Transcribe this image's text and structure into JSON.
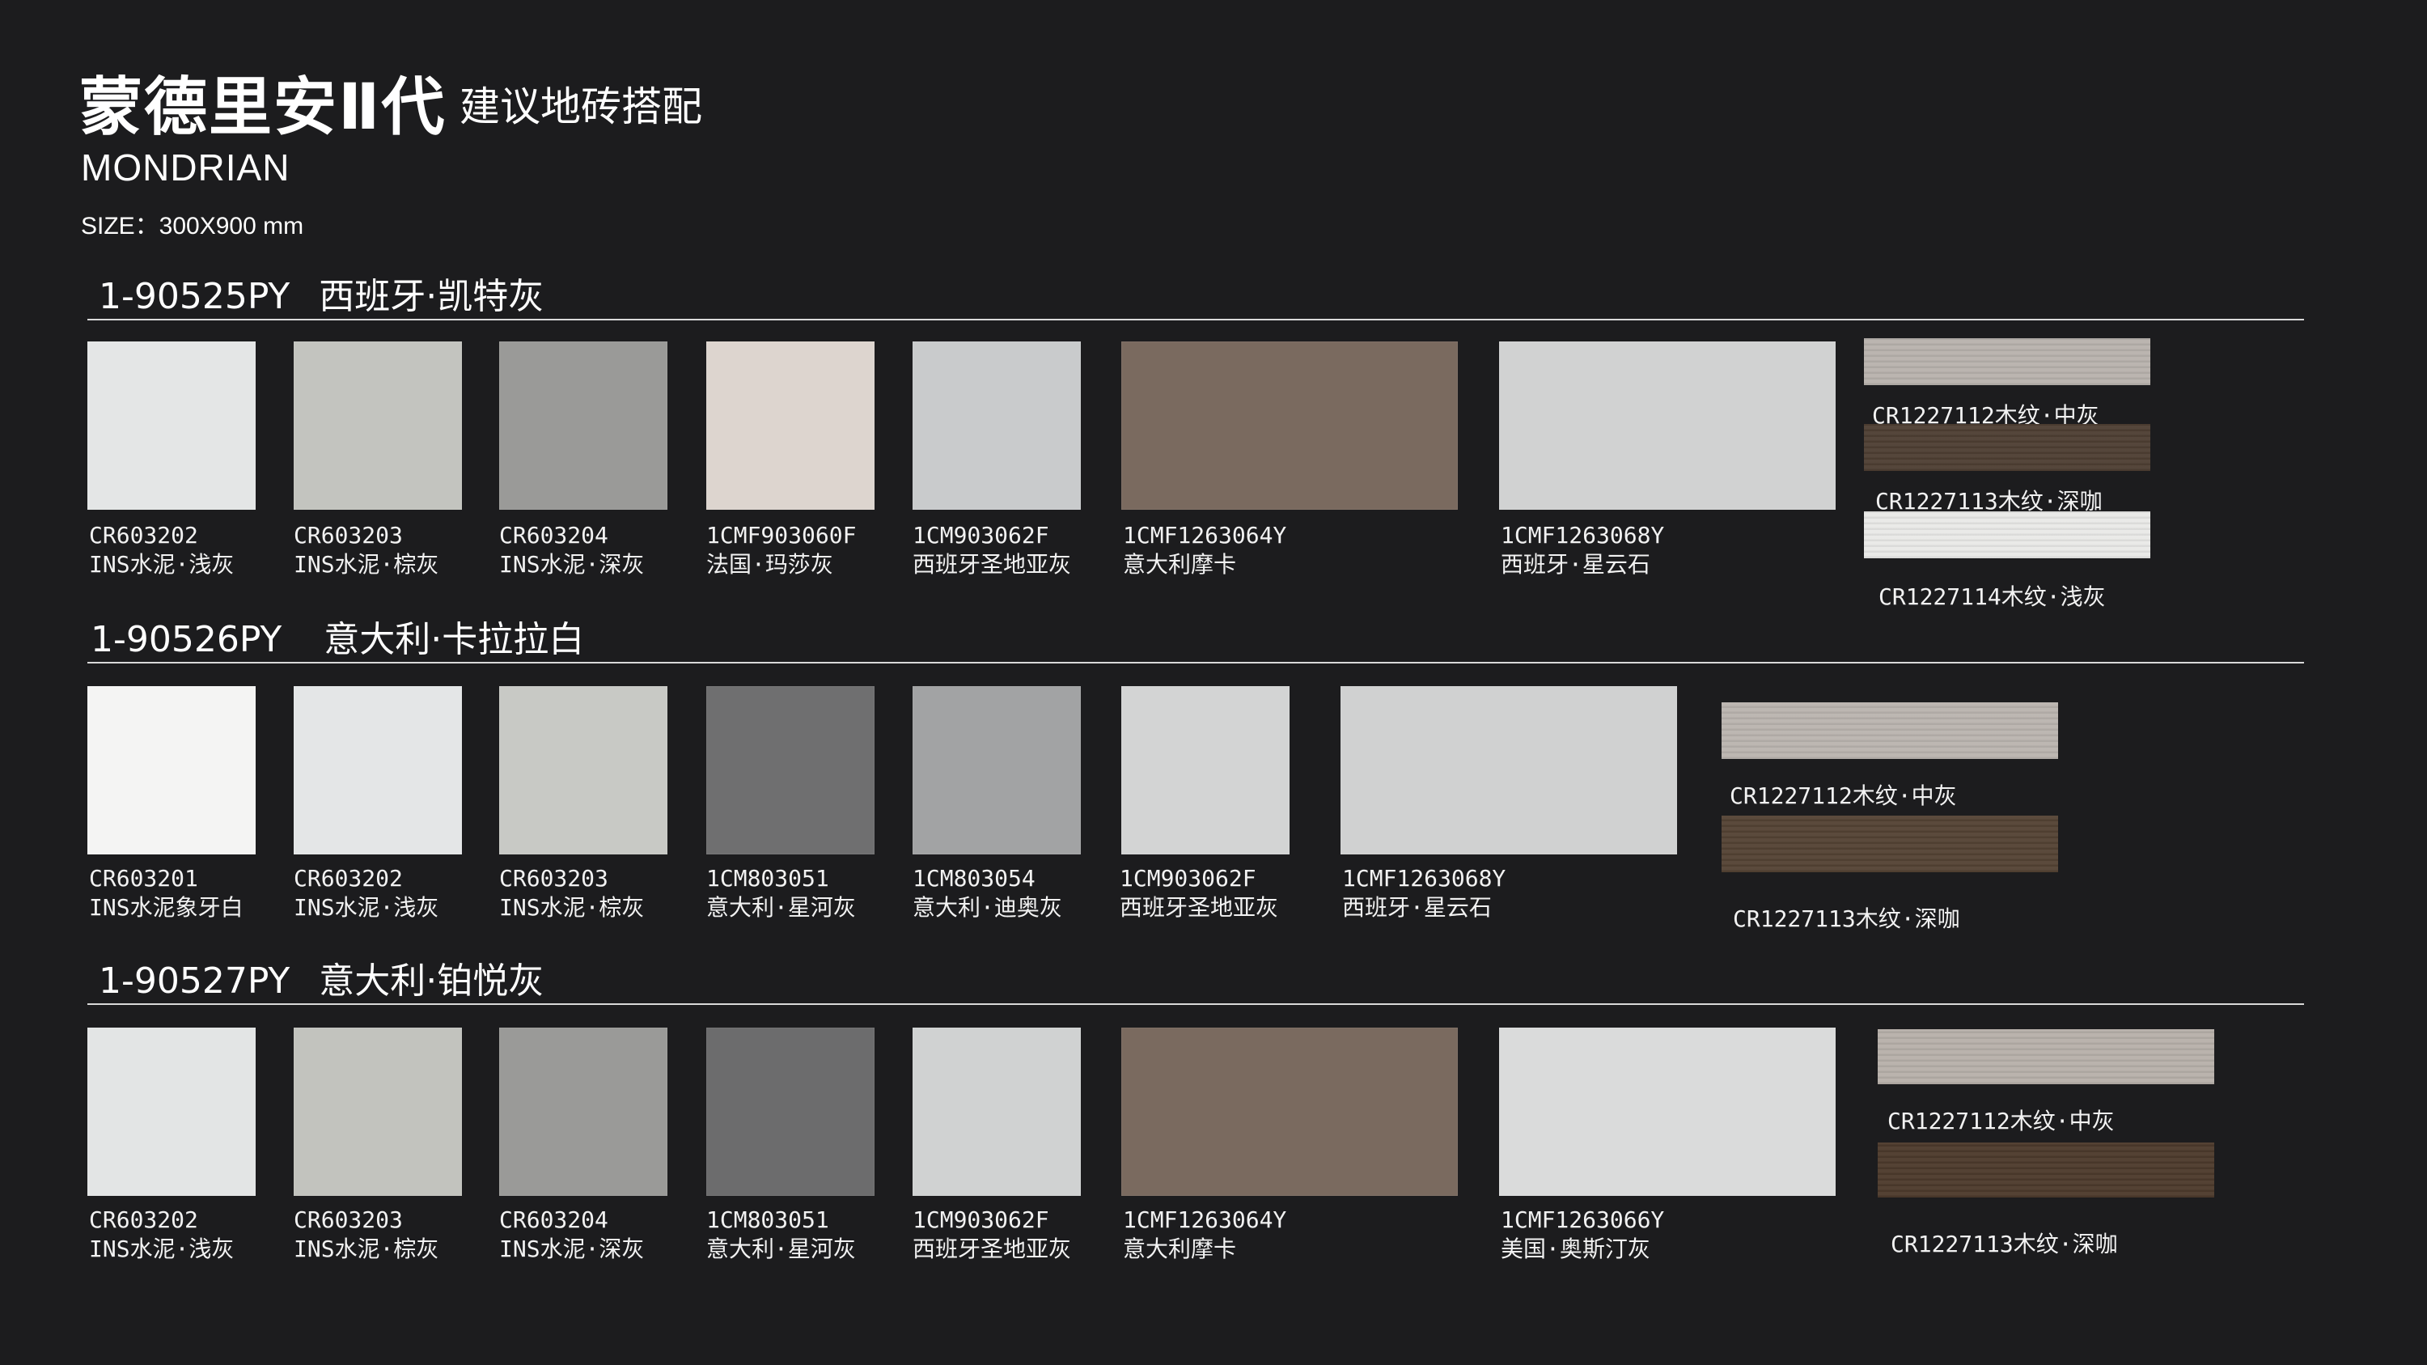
{
  "header": {
    "title": "蒙德里安Ⅱ代",
    "subtitle": "建议地砖搭配",
    "brand": "MONDRIAN",
    "size": "SIZE：300X900 mm"
  },
  "sections": [
    {
      "code": "1-90525PY",
      "name": "西班牙·凯特灰",
      "tiles": [
        {
          "code": "CR603202",
          "name": "INS水泥·浅灰",
          "color": "#e4e6e6"
        },
        {
          "code": "CR603203",
          "name": "INS水泥·棕灰",
          "color": "#c3c4bf"
        },
        {
          "code": "CR603204",
          "name": "INS水泥·深灰",
          "color": "#9a9a98"
        },
        {
          "code": "1CMF903060F",
          "name": "法国·玛莎灰",
          "color": "#ddd5cf"
        },
        {
          "code": "1CM903062F",
          "name": "西班牙圣地亚灰",
          "color": "#c9cbcc"
        },
        {
          "code": "1CMF1263064Y",
          "name": "意大利摩卡",
          "color": "#7a6a5f"
        },
        {
          "code": "1CMF1263068Y",
          "name": "西班牙·星云石",
          "color": "#d1d2d2"
        }
      ],
      "woods": [
        {
          "label": "CR1227112木纹·中灰",
          "color": "#b8b2ad"
        },
        {
          "label": "CR1227113木纹·深咖",
          "color": "#4e3f33"
        },
        {
          "label": "CR1227114木纹·浅灰",
          "color": "#e9e9e7"
        }
      ]
    },
    {
      "code": "1-90526PY",
      "name": "意大利·卡拉拉白",
      "tiles": [
        {
          "code": "CR603201",
          "name": "INS水泥象牙白",
          "color": "#f4f4f3"
        },
        {
          "code": "CR603202",
          "name": "INS水泥·浅灰",
          "color": "#e4e6e7"
        },
        {
          "code": "CR603203",
          "name": "INS水泥·棕灰",
          "color": "#c8c9c5"
        },
        {
          "code": "1CM803051",
          "name": "意大利·星河灰",
          "color": "#6f6f70"
        },
        {
          "code": "1CM803054",
          "name": "意大利·迪奥灰",
          "color": "#a2a3a4"
        },
        {
          "code": "1CM903062F",
          "name": "西班牙圣地亚灰",
          "color": "#d3d4d4"
        },
        {
          "code": "1CMF1263068Y",
          "name": "西班牙·星云石",
          "color": "#d0d1d1"
        }
      ],
      "woods": [
        {
          "label": "CR1227112木纹·中灰",
          "color": "#bab4af"
        },
        {
          "label": "CR1227113木纹·深咖",
          "color": "#544334"
        }
      ]
    },
    {
      "code": "1-90527PY",
      "name": "意大利·铂悦灰",
      "tiles": [
        {
          "code": "CR603202",
          "name": "INS水泥·浅灰",
          "color": "#e3e5e5"
        },
        {
          "code": "CR603203",
          "name": "INS水泥·棕灰",
          "color": "#c2c3be"
        },
        {
          "code": "CR603204",
          "name": "INS水泥·深灰",
          "color": "#9a9a98"
        },
        {
          "code": "1CM803051",
          "name": "意大利·星河灰",
          "color": "#6c6c6d"
        },
        {
          "code": "1CM903062F",
          "name": "西班牙圣地亚灰",
          "color": "#d0d2d2"
        },
        {
          "code": "1CMF1263064Y",
          "name": "意大利摩卡",
          "color": "#7a6a5f"
        },
        {
          "code": "1CMF1263066Y",
          "name": "美国·奥斯汀灰",
          "color": "#dadbdb"
        }
      ],
      "woods": [
        {
          "label": "CR1227112木纹·中灰",
          "color": "#b7b0aa"
        },
        {
          "label": "CR1227113木纹·深咖",
          "color": "#4d3a2c"
        }
      ]
    }
  ]
}
